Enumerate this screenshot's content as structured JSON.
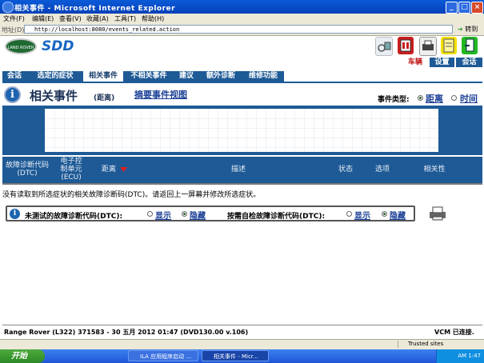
{
  "browser": {
    "title": "相关事件 - Microsoft Internet Explorer",
    "menu": [
      "文件(F)",
      "编辑(E)",
      "查看(V)",
      "收藏(A)",
      "工具(T)",
      "帮助(H)"
    ],
    "address_label": "地址(D)",
    "url": "http://localhost:8080/events_related.action",
    "go_label": "转到",
    "status_zone": "Trusted sites"
  },
  "app": {
    "logo_text": "LAND ROVER",
    "product": "SDD",
    "right_tabs": [
      "车辆",
      "设置",
      "会话"
    ]
  },
  "nav": {
    "items": [
      "会话",
      "选定的症状",
      "相关事件",
      "不相关事件",
      "建议",
      "额外诊断",
      "维修功能"
    ],
    "active_index": 2
  },
  "page": {
    "title": "相关事件",
    "sort_label": "(距离)",
    "summary_link": "摘要事件视图",
    "event_type_label": "事件类型:",
    "event_type_options": [
      "距离",
      "时间"
    ],
    "event_type_selected": 0
  },
  "table": {
    "headers": {
      "dtc": "故障诊断代码\n(DTC)",
      "ecu": "电子控\n制单元\n(ECU)",
      "distance": "距离",
      "description": "描述",
      "status": "状态",
      "options": "选项",
      "relevance": "相关性"
    }
  },
  "messages": {
    "no_dtc": "没有读取到所选症状的相关故障诊断码(DTC)。请返回上一屏幕并修改所选症状。"
  },
  "dtc_filter": {
    "untested_label": "未测试的故障诊断代码(DTC):",
    "on_demand_label": "按需自检故障诊断代码(DTC):",
    "show": "显示",
    "hide": "隐藏",
    "untested_selected": "hide",
    "on_demand_selected": "hide"
  },
  "footer": {
    "vehicle": "Range Rover (L322) 371583 - 30 五月 2012 01:47 (DVD130.00 v.106)",
    "vcm": "VCM 已连接."
  },
  "taskbar": {
    "start": "开始",
    "tasks": [
      "ILA 应用程序启动 ...",
      "相关事件 - Micr..."
    ],
    "clock": "AM 1:47"
  }
}
